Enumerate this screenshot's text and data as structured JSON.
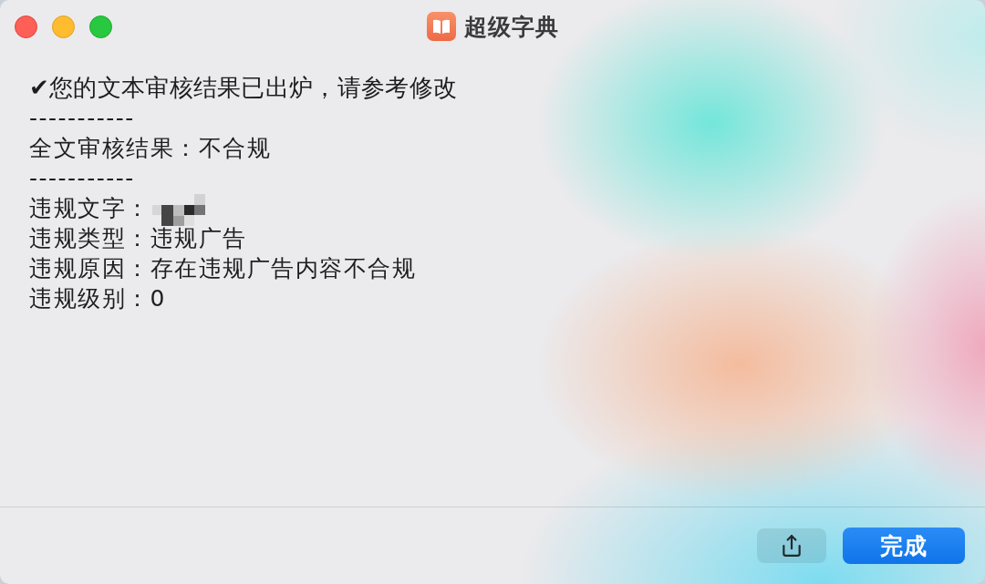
{
  "window": {
    "title": "超级字典",
    "controls": [
      {
        "kind": "close"
      },
      {
        "kind": "minimize"
      },
      {
        "kind": "zoom"
      }
    ]
  },
  "report": {
    "lines": [
      {
        "kind": "heading",
        "text": "✔您的文本审核结果已出炉，请参考修改"
      },
      {
        "kind": "rule",
        "text": "-----------"
      },
      {
        "kind": "field",
        "text": "全文审核结果：不合规"
      },
      {
        "kind": "rule",
        "text": "-----------"
      },
      {
        "kind": "redacted",
        "text": "违规文字："
      },
      {
        "kind": "field",
        "text": "违规类型：违规广告"
      },
      {
        "kind": "field",
        "text": "违规原因：存在违规广告内容不合规"
      },
      {
        "kind": "field",
        "text": "违规级别：0"
      }
    ]
  },
  "footer": {
    "buttons": [
      {
        "kind": "share"
      },
      {
        "kind": "primary",
        "label": "完成"
      }
    ]
  }
}
